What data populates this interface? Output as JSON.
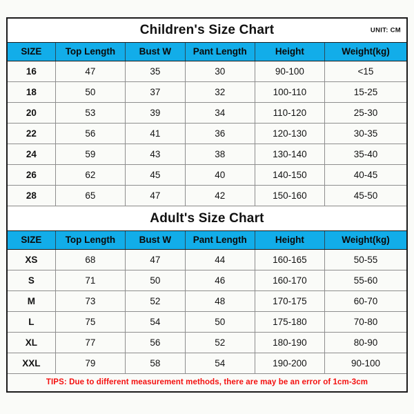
{
  "background_color": "#fafbf8",
  "header_color": "#12ade9",
  "tips_color": "#f4100f",
  "border_color": "#1a1a1a",
  "children": {
    "title": "Children's Size Chart",
    "unit": "UNIT: CM",
    "columns": [
      "SIZE",
      "Top Length",
      "Bust W",
      "Pant Length",
      "Height",
      "Weight(kg)"
    ],
    "rows": [
      [
        "16",
        "47",
        "35",
        "30",
        "90-100",
        "<15"
      ],
      [
        "18",
        "50",
        "37",
        "32",
        "100-110",
        "15-25"
      ],
      [
        "20",
        "53",
        "39",
        "34",
        "110-120",
        "25-30"
      ],
      [
        "22",
        "56",
        "41",
        "36",
        "120-130",
        "30-35"
      ],
      [
        "24",
        "59",
        "43",
        "38",
        "130-140",
        "35-40"
      ],
      [
        "26",
        "62",
        "45",
        "40",
        "140-150",
        "40-45"
      ],
      [
        "28",
        "65",
        "47",
        "42",
        "150-160",
        "45-50"
      ]
    ]
  },
  "adults": {
    "title": "Adult's Size Chart",
    "columns": [
      "SIZE",
      "Top Length",
      "Bust W",
      "Pant Length",
      "Height",
      "Weight(kg)"
    ],
    "rows": [
      [
        "XS",
        "68",
        "47",
        "44",
        "160-165",
        "50-55"
      ],
      [
        "S",
        "71",
        "50",
        "46",
        "160-170",
        "55-60"
      ],
      [
        "M",
        "73",
        "52",
        "48",
        "170-175",
        "60-70"
      ],
      [
        "L",
        "75",
        "54",
        "50",
        "175-180",
        "70-80"
      ],
      [
        "XL",
        "77",
        "56",
        "52",
        "180-190",
        "80-90"
      ],
      [
        "XXL",
        "79",
        "58",
        "54",
        "190-200",
        "90-100"
      ]
    ]
  },
  "tips": "TIPS: Due to different measurement methods, there are may be an error of 1cm-3cm"
}
